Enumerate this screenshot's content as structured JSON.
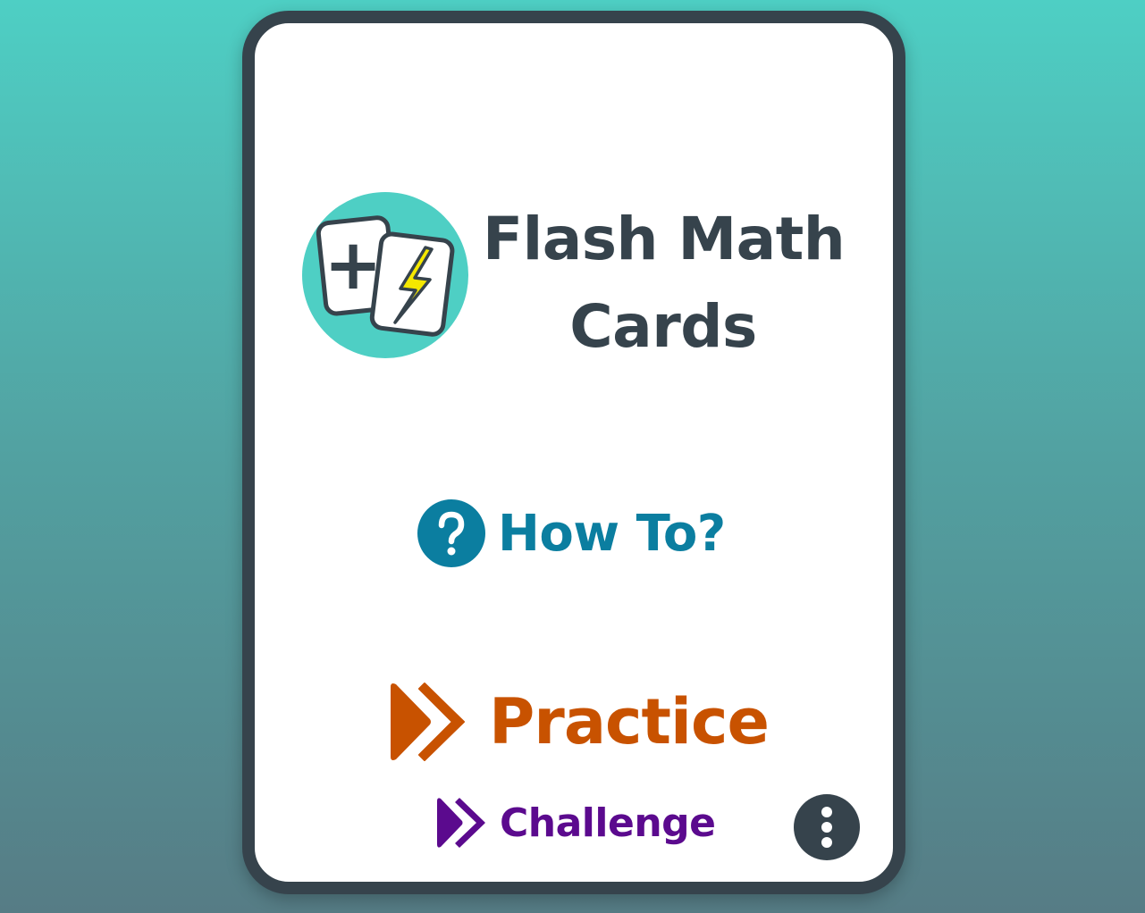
{
  "app": {
    "title_line1": "Flash Math",
    "title_line2": "Cards"
  },
  "logo": {
    "icon": "flash-cards-logo",
    "plus_symbol": "+",
    "colors": {
      "circle": "#4ecfc4",
      "bolt": "#f5e800",
      "outline": "#36434c"
    }
  },
  "menu": {
    "howto_label": "How To?",
    "howto_icon": "question-circle-icon",
    "practice_label": "Practice",
    "practice_icon": "double-chevron-right-icon",
    "challenge_label": "Challenge",
    "challenge_icon": "double-chevron-right-icon",
    "more_icon": "vertical-ellipsis-icon"
  },
  "colors": {
    "background_top": "#4ecfc4",
    "background_bottom": "#567c85",
    "card_border": "#36434c",
    "title": "#36434c",
    "howto": "#0b7ea0",
    "practice": "#c85200",
    "challenge": "#5b0a8e"
  }
}
